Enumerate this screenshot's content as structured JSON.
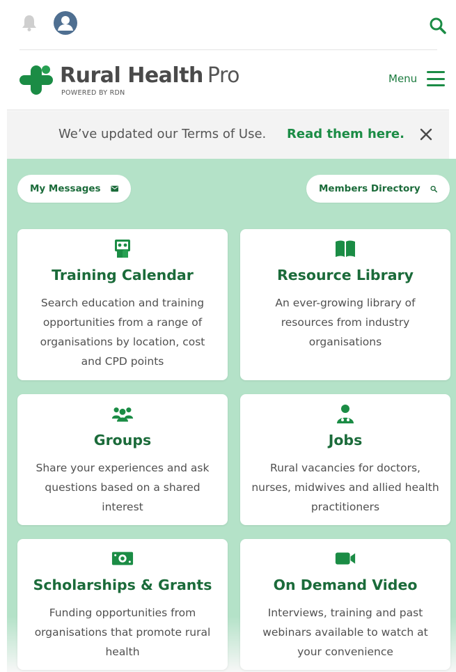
{
  "topbar": {
    "notifications_icon": "bell-icon",
    "profile_icon": "user-avatar-icon",
    "search_icon": "search-icon"
  },
  "brand": {
    "name_bold": "Rural Health",
    "name_light": "Pro",
    "tagline": "POWERED BY RDN",
    "logo_icon": "cross-logo-icon"
  },
  "menu": {
    "label": "Menu",
    "icon": "hamburger-icon"
  },
  "notice": {
    "text": "We’ve updated our Terms of Use.",
    "link": "Read them here.",
    "close_icon": "close-icon"
  },
  "quick_links": {
    "messages": {
      "label": "My Messages",
      "icon": "envelope-icon"
    },
    "directory": {
      "label": "Members Directory",
      "icon": "search-icon"
    }
  },
  "cards": [
    {
      "title": "Training Calendar",
      "description": "Search education and training opportunities from a range of organisations by location, cost and CPD points",
      "icon": "training-board-icon"
    },
    {
      "title": "Resource Library",
      "description": "An ever-growing library of resources from industry organisations",
      "icon": "open-book-icon"
    },
    {
      "title": "Groups",
      "description": "Share your experiences and ask questions based on a shared interest",
      "icon": "users-group-icon"
    },
    {
      "title": "Jobs",
      "description": "Rural vacancies for doctors, nurses, midwives and allied health practitioners",
      "icon": "doctor-icon"
    },
    {
      "title": "Scholarships & Grants",
      "description": "Funding opportunities from organisations that promote rural health",
      "icon": "money-bill-icon"
    },
    {
      "title": "On Demand Video",
      "description": "Interviews, training and past webinars available to watch at your convenience",
      "icon": "video-camera-icon"
    }
  ],
  "colors": {
    "brand_green": "#1b8c45",
    "title_green": "#1b6b3a",
    "panel_green": "#b4e2c8",
    "notice_bg": "#f3f3f3"
  }
}
